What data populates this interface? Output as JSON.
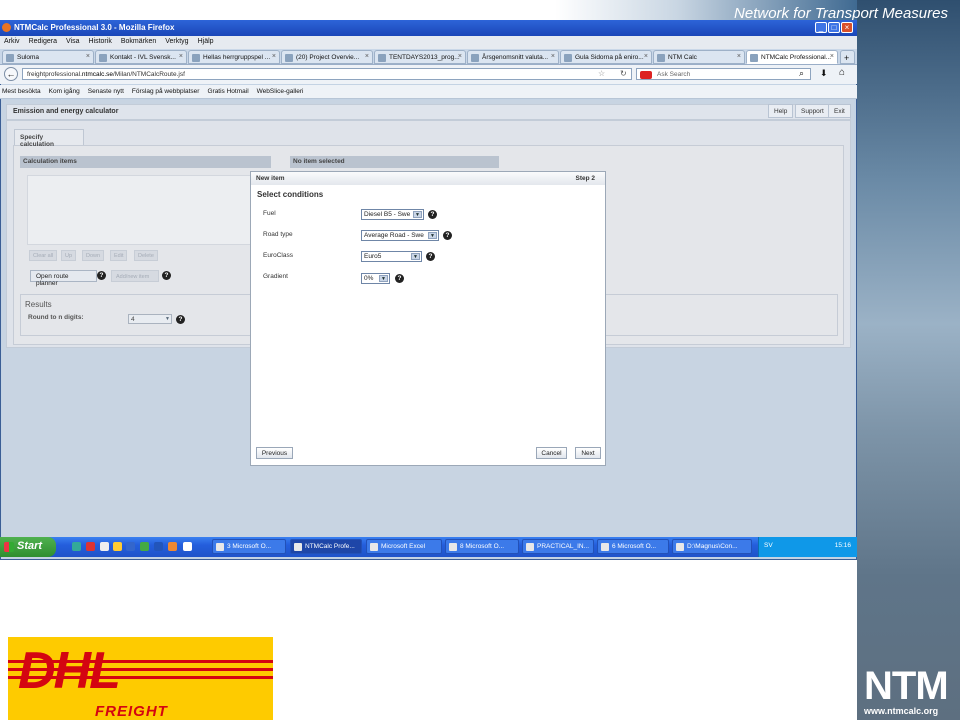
{
  "slide": {
    "title": "Network for Transport Measures",
    "logo_text": "NTM",
    "logo_url": "www.ntmcalc.org",
    "dhl_logo": "DHL",
    "dhl_sub": "FREIGHT"
  },
  "browser": {
    "title": "NTMCalc Professional 3.0 - Mozilla Firefox",
    "menu": [
      "Arkiv",
      "Redigera",
      "Visa",
      "Historik",
      "Bokmärken",
      "Verktyg",
      "Hjälp"
    ],
    "tabs": [
      "Suloma",
      "Kontakt - IVL Svensk...",
      "Hellas herrgruppspel ...",
      "(20) Project Overvie...",
      "TENTDAYS2013_prog...",
      "Årsgenomsnitt valuta...",
      "Gula Sidorna på eniro...",
      "NTM Calc",
      "NTMCalc Professional..."
    ],
    "url_prefix": "freightprofessional.",
    "url_domain": "ntmcalc.se",
    "url_suffix": "/Milan/NTMCalcRoute.jsf",
    "search_placeholder": "Ask Search",
    "bookmarks": [
      "Mest besökta",
      "Kom igång",
      "Senaste nytt",
      "Förslag på webbplatser",
      "Gratis Hotmail",
      "WebSlice-galleri"
    ]
  },
  "app": {
    "header": "Emission and energy calculator",
    "header_buttons": [
      "Help",
      "Support",
      "Exit"
    ],
    "tab_specify": "Specify calculation",
    "calc_items_label": "Calculation items",
    "no_item_label": "No item selected",
    "item_buttons": [
      "Clear all",
      "Up",
      "Down",
      "Edit",
      "Delete"
    ],
    "open_route_planner": "Open route planner",
    "add_item": "Add/new item",
    "results_label": "Results",
    "round_label": "Round to n digits:",
    "round_value": "4"
  },
  "modal": {
    "title": "New item",
    "step": "Step 2",
    "heading": "Select conditions",
    "fields": [
      {
        "label": "Fuel",
        "value": "Diesel B5 - Swe"
      },
      {
        "label": "Road type",
        "value": "Average Road - Swe"
      },
      {
        "label": "EuroClass",
        "value": "Euro5"
      },
      {
        "label": "Gradient",
        "value": "0%"
      }
    ],
    "previous": "Previous",
    "cancel": "Cancel",
    "next": "Next"
  },
  "taskbar": {
    "start": "Start",
    "items": [
      "3 Microsoft O...",
      "NTMCalc Profe...",
      "Microsoft Excel",
      "8 Microsoft O...",
      "PRACTICAL_IN...",
      "6 Microsoft O...",
      "D:\\Magnus\\Con..."
    ],
    "lang": "SV",
    "clock": "15:16"
  }
}
